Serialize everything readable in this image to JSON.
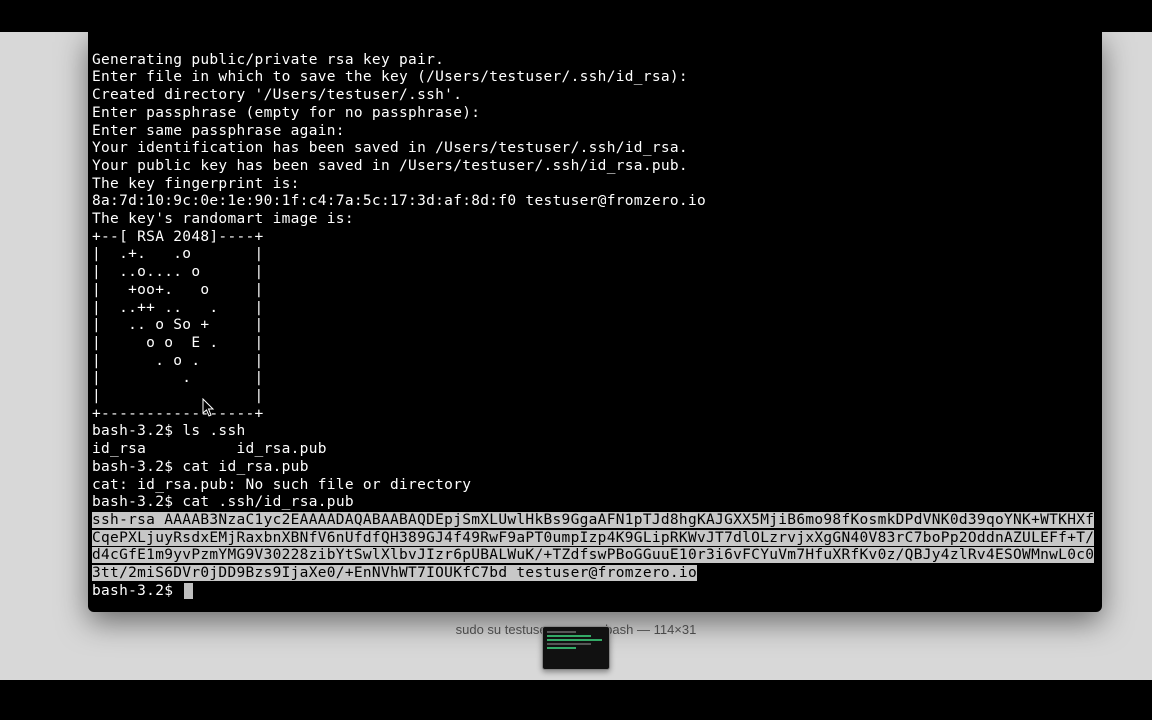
{
  "window": {
    "title": "sudo su testuser — su — bash — 114×31"
  },
  "terminal": {
    "lines": [
      "Generating public/private rsa key pair.",
      "Enter file in which to save the key (/Users/testuser/.ssh/id_rsa):",
      "Created directory '/Users/testuser/.ssh'.",
      "Enter passphrase (empty for no passphrase):",
      "Enter same passphrase again:",
      "Your identification has been saved in /Users/testuser/.ssh/id_rsa.",
      "Your public key has been saved in /Users/testuser/.ssh/id_rsa.pub.",
      "The key fingerprint is:",
      "8a:7d:10:9c:0e:1e:90:1f:c4:7a:5c:17:3d:af:8d:f0 testuser@fromzero.io",
      "The key's randomart image is:",
      "+--[ RSA 2048]----+",
      "|  .+.   .o       |",
      "|  ..o.... o      |",
      "|   +oo+.   o     |",
      "|  ..++ ..   .    |",
      "|   .. o So +     |",
      "|     o o  E .    |",
      "|      . o .      |",
      "|         .       |",
      "|                 |",
      "+-----------------+"
    ],
    "cmd1_prompt": "bash-3.2$ ",
    "cmd1": "ls .ssh",
    "cmd1_output": "id_rsa          id_rsa.pub",
    "cmd2_prompt": "bash-3.2$ ",
    "cmd2": "cat id_rsa.pub",
    "cmd2_output": "cat: id_rsa.pub: No such file or directory",
    "cmd3_prompt": "bash-3.2$ ",
    "cmd3": "cat .ssh/id_rsa.pub",
    "pubkey": "ssh-rsa AAAAB3NzaC1yc2EAAAADAQABAABAQDEpjSmXLUwlHkBs9GgaAFN1pTJd8hgKAJGXX5MjiB6mo98fKosmkDPdVNK0d39qoYNK+WTKHXfCqePXLjuyRsdxEMjRaxbnXBNfV6nUfdfQH389GJ4f49RwF9aPT0umpIzp4K9GLipRKWvJT7dlOLzrvjxXgGN40V83rC7boPp2OddnAZULEFf+T/d4cGfE1m9yvPzmYMG9V30228zibYtSwlXlbvJIzr6pUBALWuK/+TZdfswPBoGGuuE10r3i6vFCYuVm7HfuXRfKv0z/QBJy4zlRv4ESOWMnwL0c03tt/2miS6DVr0jDD9Bzs9IjaXe0/+EnNVhWT7IOUKfC7bd testuser@fromzero.io",
    "final_prompt": "bash-3.2$ "
  }
}
